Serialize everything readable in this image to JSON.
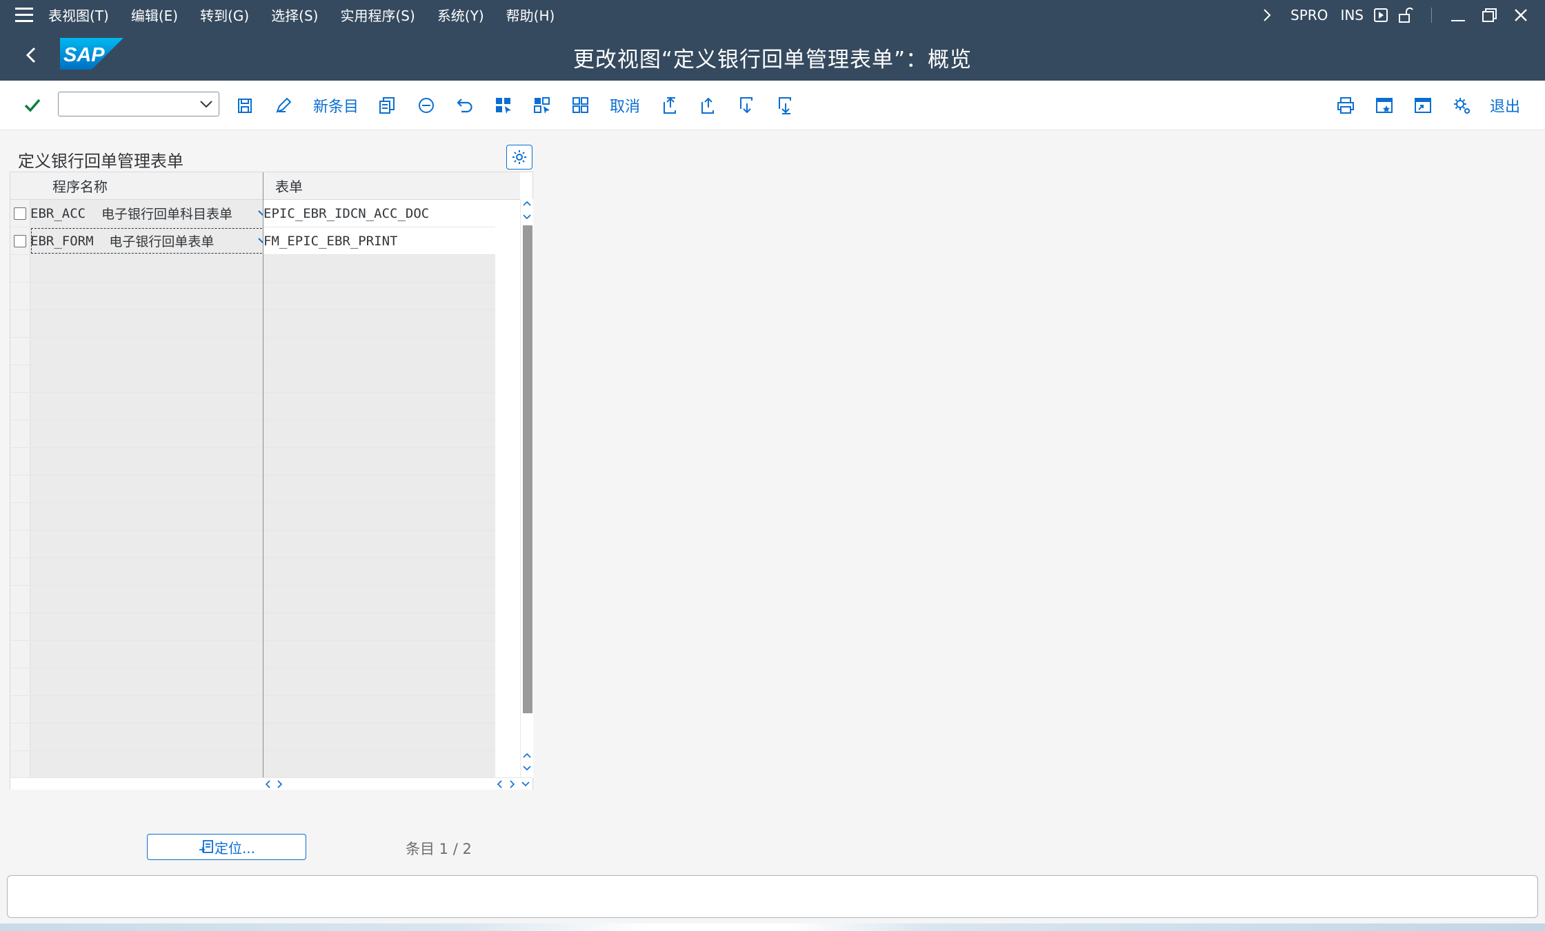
{
  "menubar": {
    "items": [
      "表视图(T)",
      "编辑(E)",
      "转到(G)",
      "选择(S)",
      "实用程序(S)",
      "系统(Y)",
      "帮助(H)"
    ],
    "transaction": "SPRO",
    "mode": "INS"
  },
  "titlebar": {
    "logo_text": "SAP",
    "title": "更改视图“定义银行回单管理表单”：概览"
  },
  "toolbar": {
    "command_value": "",
    "new_entries_label": "新条目",
    "cancel_label": "取消",
    "exit_label": "退出"
  },
  "table": {
    "title": "定义银行回单管理表单",
    "columns": [
      "程序名称",
      "表单"
    ],
    "rows": [
      {
        "program": "EBR_ACC",
        "program_text": "电子银行回单科目表单",
        "form": "EPIC_EBR_IDCN_ACC_DOC"
      },
      {
        "program": "EBR_FORM",
        "program_text": "电子银行回单表单",
        "form": "FM_EPIC_EBR_PRINT"
      }
    ]
  },
  "footer": {
    "position_label": "定位...",
    "entry_label": "条目 1 / 2"
  },
  "colors": {
    "shell": "#354a5f",
    "accent": "#0a6ed1",
    "confirm": "#107e3e"
  },
  "icons": [
    "menu-icon",
    "back-icon",
    "check-icon",
    "dropdown-icon",
    "save-icon",
    "edit-icon",
    "copy-icon",
    "delete-icon",
    "undo-icon",
    "select-all-icon",
    "select-block-icon",
    "deselect-all-icon",
    "first-page-icon",
    "previous-page-icon",
    "next-page-icon",
    "last-page-icon",
    "print-icon",
    "create-session-icon",
    "generate-shortcut-icon",
    "settings-icon"
  ]
}
